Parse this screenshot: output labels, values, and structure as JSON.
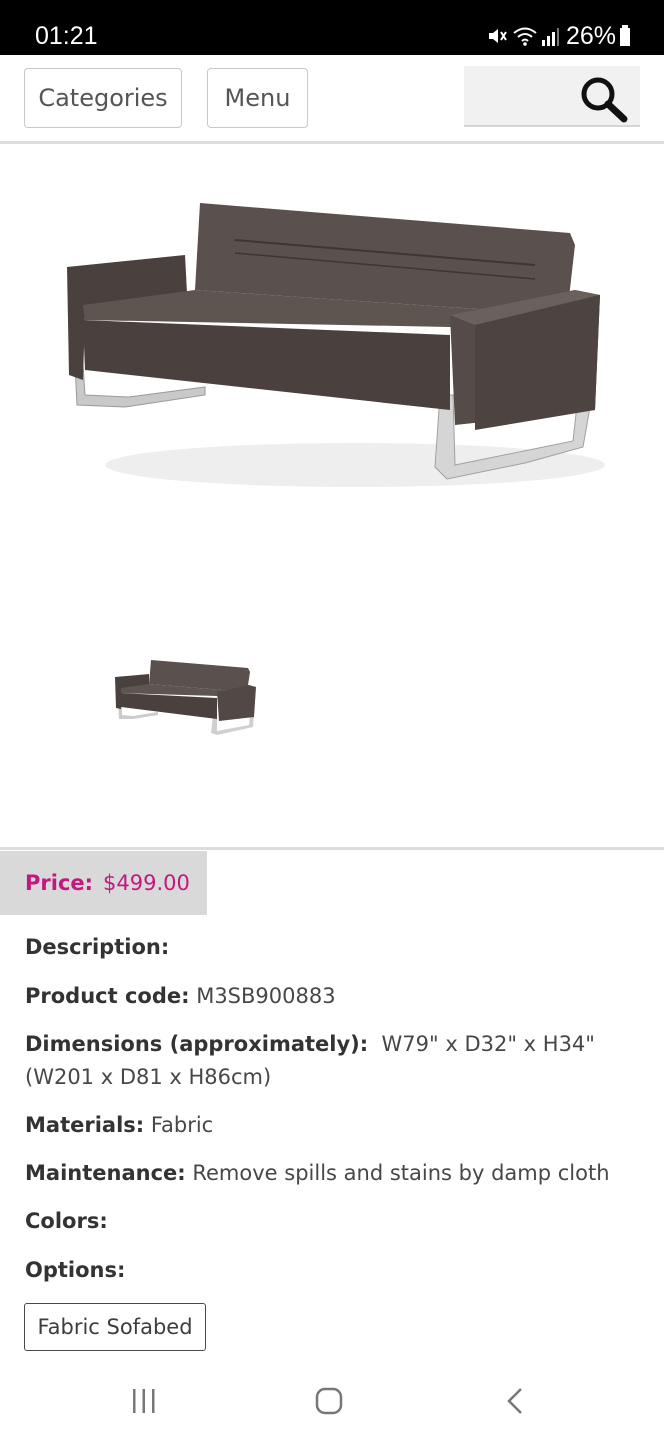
{
  "status_bar": {
    "time": "01:21",
    "battery": "26%",
    "icons": [
      "mute-icon",
      "wifi-icon",
      "signal-icon",
      "battery-icon"
    ]
  },
  "nav": {
    "categories_label": "Categories",
    "menu_label": "Menu",
    "search_icon": "search-icon"
  },
  "product": {
    "price_label": "Price:",
    "price_value": "$499.00",
    "description_label": "Description:",
    "product_code_label": "Product code:",
    "product_code_value": "M3SB900883",
    "dimensions_label": "Dimensions (approximately):",
    "dimensions_value": "W79\" x D32\" x H34\" (W201 x D81 x H86cm)",
    "materials_label": "Materials:",
    "materials_value": "Fabric",
    "maintenance_label": "Maintenance:",
    "maintenance_value": "Remove spills and stains by damp cloth",
    "colors_label": "Colors:",
    "options_label": "Options:",
    "option_selected": "Fabric Sofabed"
  },
  "android_nav": {
    "icons": [
      "recent-apps-icon",
      "home-icon",
      "back-icon"
    ]
  },
  "colors": {
    "price_accent": "#c2187f",
    "sofa_fabric": "#4f4643",
    "status_bar_bg": "#000000"
  }
}
